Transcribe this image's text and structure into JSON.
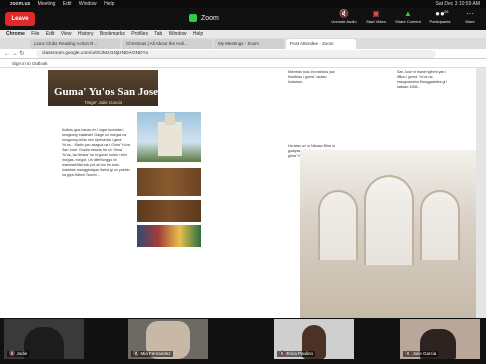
{
  "mac_menu": {
    "apple": "",
    "app": "zoom.us",
    "items": [
      "Meeting",
      "Edit",
      "Window",
      "Help"
    ],
    "right_time": "Sat Dec 3  10:59 AM",
    "zoom_mode": "Zoom"
  },
  "zoom_bar": {
    "leave_label": "Leave",
    "title": "Zoom",
    "buttons": [
      {
        "label": "Unmute Audio",
        "icon": "microphone-slash-icon"
      },
      {
        "label": "Start Video",
        "icon": "video-camera-slash-icon"
      },
      {
        "label": "Share Content",
        "icon": "share-screen-icon"
      },
      {
        "label": "Participants",
        "icon": "participants-icon",
        "badge": "26"
      },
      {
        "label": "More",
        "icon": "more-icon"
      }
    ]
  },
  "chrome_menu": [
    "Chrome",
    "File",
    "Edit",
    "View",
    "History",
    "Bookmarks",
    "Profiles",
    "Tab",
    "Window",
    "Help"
  ],
  "tabs": [
    {
      "label": "Lions Clubs Reading Action R...",
      "active": false
    },
    {
      "label": "Christmas | All About the Holi...",
      "active": false
    },
    {
      "label": "My Meetings - Zoom",
      "active": false
    },
    {
      "label": "Post Attendee - Zoom",
      "active": true
    }
  ],
  "url": "classroom.google.com/u/0/c/MzI1NjIzNDAONDYx",
  "bookmarks_label": "Sign in to Outlook",
  "article": {
    "title": "Guma' Yu'os San Jose",
    "subtitle": "Tinige' Julie Garcia",
    "col1": "Kuāntu gua hanao en i lugar bumisita I songsong Inalahan! Gaige un ma'gas na songsong ta'lao sén ripresenta i gima' Yu'os... Matto yan asagua-na i Gima' Yu'os San Jose. Guaha estoria-ña ni i Gima' Yu'os, lao tinaka' ha ni guma' kulan i ta'lo ma'gas, ma'gof. Un difet'tunggo ini manmaleñita tulo pot an kin fin todo. Inalahan mangginaiyan ñaihá gi un pueblo na giya Halom Tanom...",
    "col2": "Mientras todu ini mafotos yan fina'tinas i guma', taotao Inalahan...",
    "col3": "San Jose ni mané'ngfrent yan i lifitun i guma' Yu'os na mangnanaina Manggatañes gi i sakkan 1908...",
    "col4": "Ha atan un 'sí Näman Biha ni guaiyasan kulan matata'chong i gima' Yu'os Santa Rosa..."
  },
  "participants": [
    {
      "name": "Jodie",
      "muted": true
    },
    {
      "name": "Mia Fernandez",
      "muted": true
    },
    {
      "name": "Erica Paulino",
      "muted": true
    },
    {
      "name": "Julie Garcia",
      "muted": true
    }
  ]
}
